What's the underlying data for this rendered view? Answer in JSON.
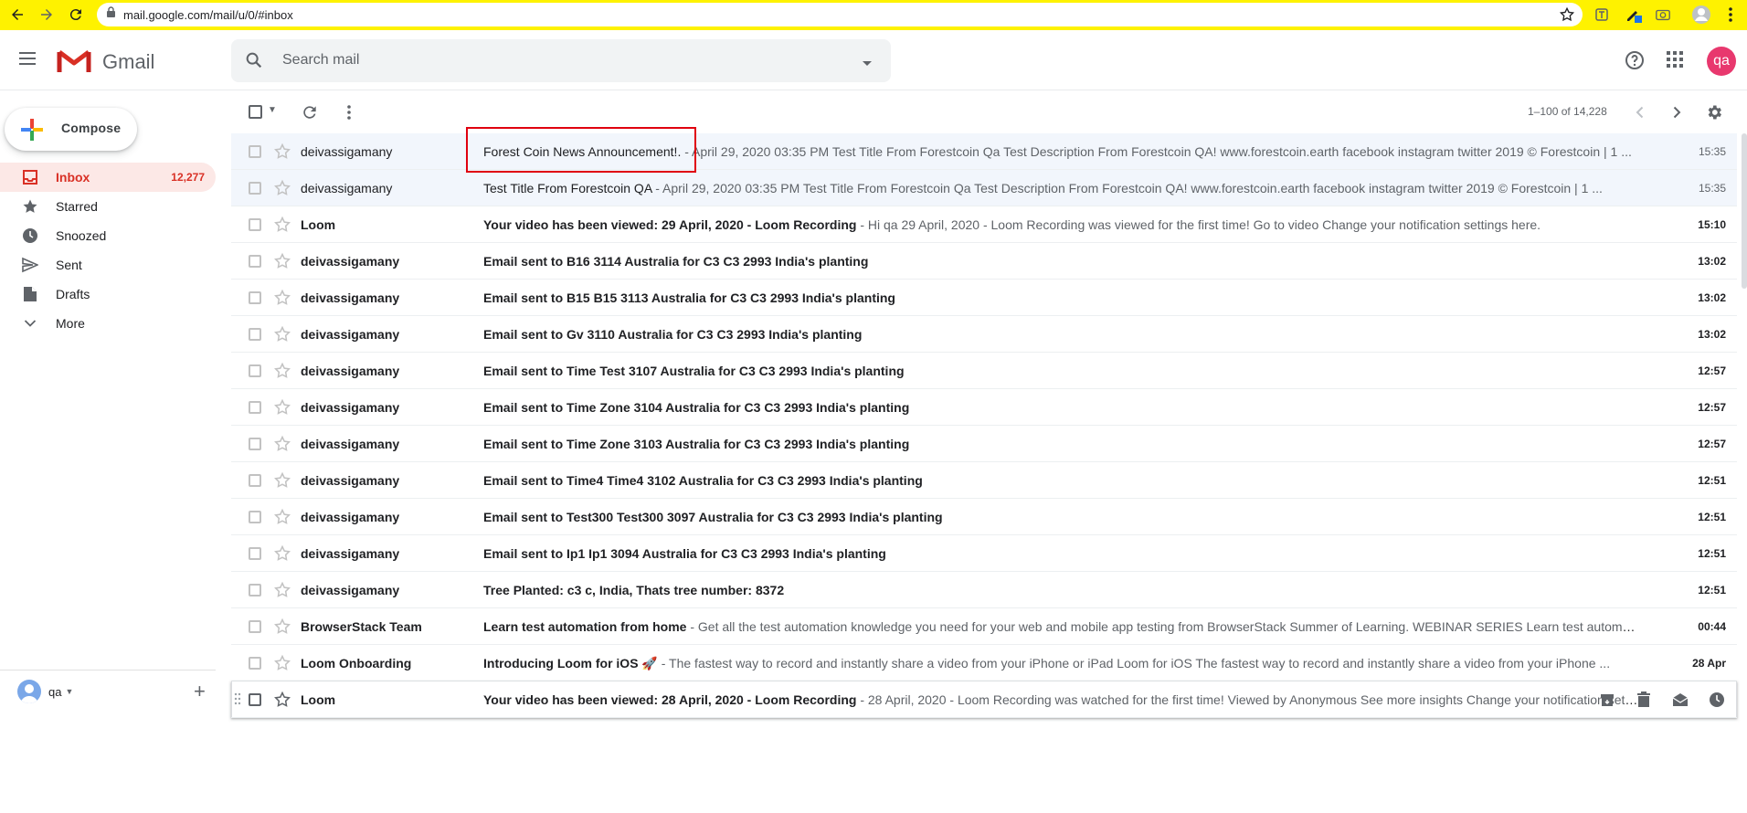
{
  "browser": {
    "url": "mail.google.com/mail/u/0/#inbox"
  },
  "header": {
    "app_name": "Gmail",
    "search_placeholder": "Search mail",
    "avatar_initials": "qa"
  },
  "sidebar": {
    "compose_label": "Compose",
    "items": [
      {
        "label": "Inbox",
        "count": "12,277",
        "icon": "inbox-icon",
        "active": true
      },
      {
        "label": "Starred",
        "count": "",
        "icon": "star-icon",
        "active": false
      },
      {
        "label": "Snoozed",
        "count": "",
        "icon": "clock-icon",
        "active": false
      },
      {
        "label": "Sent",
        "count": "",
        "icon": "send-icon",
        "active": false
      },
      {
        "label": "Drafts",
        "count": "",
        "icon": "draft-icon",
        "active": false
      },
      {
        "label": "More",
        "count": "",
        "icon": "chevron-down-icon",
        "active": false
      }
    ],
    "account_name": "qa"
  },
  "toolbar": {
    "pager_text": "1–100 of 14,228"
  },
  "emails": [
    {
      "sender": "deivassigamany",
      "subject": "Forest Coin News Announcement!.",
      "snippet": " - April 29, 2020 03:35 PM Test Title From Forestcoin Qa Test Description From Forestcoin QA! www.forestcoin.earth facebook instagram twitter 2019 © Forestcoin | 1 ...",
      "date": "15:35",
      "state": "read"
    },
    {
      "sender": "deivassigamany",
      "subject": "Test Title From Forestcoin QA",
      "snippet": " - April 29, 2020 03:35 PM Test Title From Forestcoin Qa Test Description From Forestcoin QA! www.forestcoin.earth facebook instagram twitter 2019 © Forestcoin | 1 ...",
      "date": "15:35",
      "state": "read"
    },
    {
      "sender": "Loom",
      "subject": "Your video has been viewed: 29 April, 2020 - Loom Recording",
      "snippet": " - Hi qa 29 April, 2020 - Loom Recording was viewed for the first time! Go to video Change your notification settings here.",
      "date": "15:10",
      "state": "unread"
    },
    {
      "sender": "deivassigamany",
      "subject": "Email sent to B16 3114 Australia for C3 C3 2993 India's planting",
      "snippet": "",
      "date": "13:02",
      "state": "unread"
    },
    {
      "sender": "deivassigamany",
      "subject": "Email sent to B15 B15 3113 Australia for C3 C3 2993 India's planting",
      "snippet": "",
      "date": "13:02",
      "state": "unread"
    },
    {
      "sender": "deivassigamany",
      "subject": "Email sent to Gv 3110 Australia for C3 C3 2993 India's planting",
      "snippet": "",
      "date": "13:02",
      "state": "unread"
    },
    {
      "sender": "deivassigamany",
      "subject": "Email sent to Time Test 3107 Australia for C3 C3 2993 India's planting",
      "snippet": "",
      "date": "12:57",
      "state": "unread"
    },
    {
      "sender": "deivassigamany",
      "subject": "Email sent to Time Zone 3104 Australia for C3 C3 2993 India's planting",
      "snippet": "",
      "date": "12:57",
      "state": "unread"
    },
    {
      "sender": "deivassigamany",
      "subject": "Email sent to Time Zone 3103 Australia for C3 C3 2993 India's planting",
      "snippet": "",
      "date": "12:57",
      "state": "unread"
    },
    {
      "sender": "deivassigamany",
      "subject": "Email sent to Time4 Time4 3102 Australia for C3 C3 2993 India's planting",
      "snippet": "",
      "date": "12:51",
      "state": "unread"
    },
    {
      "sender": "deivassigamany",
      "subject": "Email sent to Test300 Test300 3097 Australia for C3 C3 2993 India's planting",
      "snippet": "",
      "date": "12:51",
      "state": "unread"
    },
    {
      "sender": "deivassigamany",
      "subject": "Email sent to Ip1 Ip1 3094 Australia for C3 C3 2993 India's planting",
      "snippet": "",
      "date": "12:51",
      "state": "unread"
    },
    {
      "sender": "deivassigamany",
      "subject": "Tree Planted: c3 c, India, Thats tree number: 8372",
      "snippet": "",
      "date": "12:51",
      "state": "unread"
    },
    {
      "sender": "BrowserStack Team",
      "subject": "Learn test automation from home",
      "snippet": " - Get all the test automation knowledge you need for your web and mobile app testing from BrowserStack Summer of Learning. WEBINAR SERIES Learn test automation ...",
      "date": "00:44",
      "state": "unread"
    },
    {
      "sender": "Loom Onboarding",
      "subject": "Introducing Loom for iOS 🚀",
      "snippet": " - The fastest way to record and instantly share a video from your iPhone or iPad     Loom for iOS The fastest way to record and instantly share a video from your iPhone ...",
      "date": "28 Apr",
      "state": "unread"
    },
    {
      "sender": "Loom",
      "subject": "Your video has been viewed: 28 April, 2020 - Loom Recording",
      "snippet": " - 28 April, 2020 - Loom Recording was watched for the first time! Viewed by Anonymous See more insights Change your notification settings here.",
      "date": "",
      "state": "hover"
    }
  ]
}
